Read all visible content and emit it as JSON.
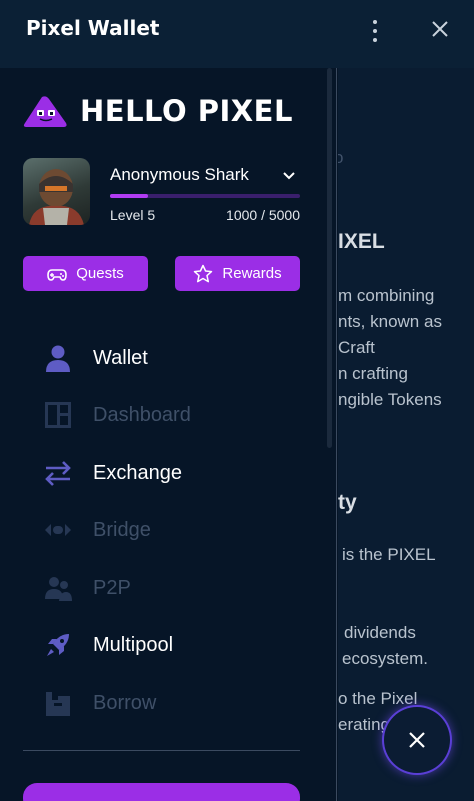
{
  "titlebar": {
    "title": "Pixel Wallet"
  },
  "brand": {
    "heading": "HELLO PIXEL"
  },
  "profile": {
    "name": "Anonymous Shark",
    "level": "Level 5",
    "xp": "1000 / 5000",
    "xp_fraction": 0.2
  },
  "actions": {
    "quests": "Quests",
    "rewards": "Rewards"
  },
  "nav": [
    {
      "label": "Wallet",
      "icon": "user-icon",
      "enabled": true
    },
    {
      "label": "Dashboard",
      "icon": "dashboard-icon",
      "enabled": false
    },
    {
      "label": "Exchange",
      "icon": "swap-arrows-icon",
      "enabled": true
    },
    {
      "label": "Bridge",
      "icon": "bridge-icon",
      "enabled": false
    },
    {
      "label": "P2P",
      "icon": "users-icon",
      "enabled": false
    },
    {
      "label": "Multipool",
      "icon": "rocket-icon",
      "enabled": true
    },
    {
      "label": "Borrow",
      "icon": "borrow-icon",
      "enabled": false
    }
  ],
  "background_text": {
    "lines": [
      "o",
      "IXEL",
      "m combining",
      "nts, known as",
      "Craft",
      "n crafting",
      "ngible Tokens",
      "ty",
      "is the PIXEL",
      "dividends",
      "ecosystem.",
      "o the Pixel",
      "erating"
    ]
  },
  "colors": {
    "accent": "#9b2ee6",
    "background": "#061527",
    "titlebar": "#0b2035",
    "disabled": "#3f5068"
  }
}
